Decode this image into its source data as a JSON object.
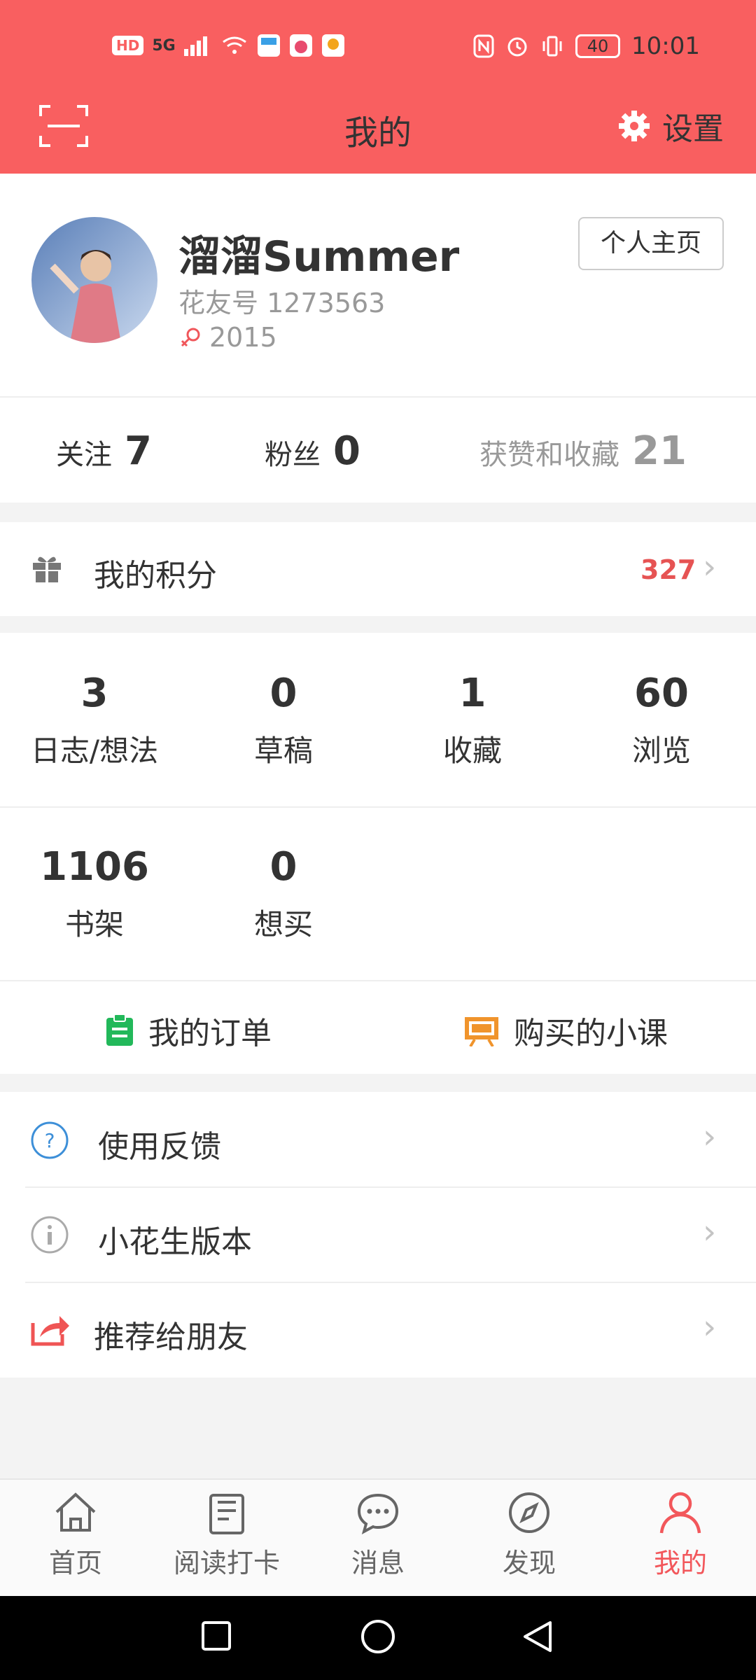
{
  "status_bar": {
    "left_icons": [
      "HD",
      "5G",
      "signal-icon",
      "wifi-icon",
      "app-icon-1",
      "app-icon-2",
      "app-icon-3"
    ],
    "hd": "HD",
    "network": "5G",
    "battery": "40",
    "time": "10:01"
  },
  "header": {
    "title": "我的",
    "settings_label": "设置"
  },
  "profile": {
    "username": "溜溜Summer",
    "uid_label": "花友号",
    "uid": "1273563",
    "year": "2015",
    "homepage_button": "个人主页"
  },
  "social": [
    {
      "label": "关注",
      "value": "7"
    },
    {
      "label": "粉丝",
      "value": "0"
    },
    {
      "label": "获赞和收藏",
      "value": "21"
    }
  ],
  "points": {
    "label": "我的积分",
    "value": "327"
  },
  "stats_row1": [
    {
      "value": "3",
      "label": "日志/想法"
    },
    {
      "value": "0",
      "label": "草稿"
    },
    {
      "value": "1",
      "label": "收藏"
    },
    {
      "value": "60",
      "label": "浏览"
    }
  ],
  "stats_row2": [
    {
      "value": "1106",
      "label": "书架"
    },
    {
      "value": "0",
      "label": "想买"
    }
  ],
  "orders": [
    {
      "label": "我的订单",
      "icon": "clipboard-icon",
      "color": "#22b85a"
    },
    {
      "label": "购买的小课",
      "icon": "presentation-icon",
      "color": "#f0942c"
    }
  ],
  "menu": [
    {
      "label": "使用反馈",
      "icon": "help-icon"
    },
    {
      "label": "小花生版本",
      "icon": "info-icon"
    },
    {
      "label": "推荐给朋友",
      "icon": "share-icon"
    }
  ],
  "tabs": [
    {
      "label": "首页",
      "icon": "home-icon"
    },
    {
      "label": "阅读打卡",
      "icon": "book-icon"
    },
    {
      "label": "消息",
      "icon": "chat-icon"
    },
    {
      "label": "发现",
      "icon": "compass-icon"
    },
    {
      "label": "我的",
      "icon": "user-icon",
      "active": true
    }
  ],
  "colors": {
    "brand": "#f95f60",
    "accent": "#e65353",
    "active_tab": "#f2575b"
  }
}
